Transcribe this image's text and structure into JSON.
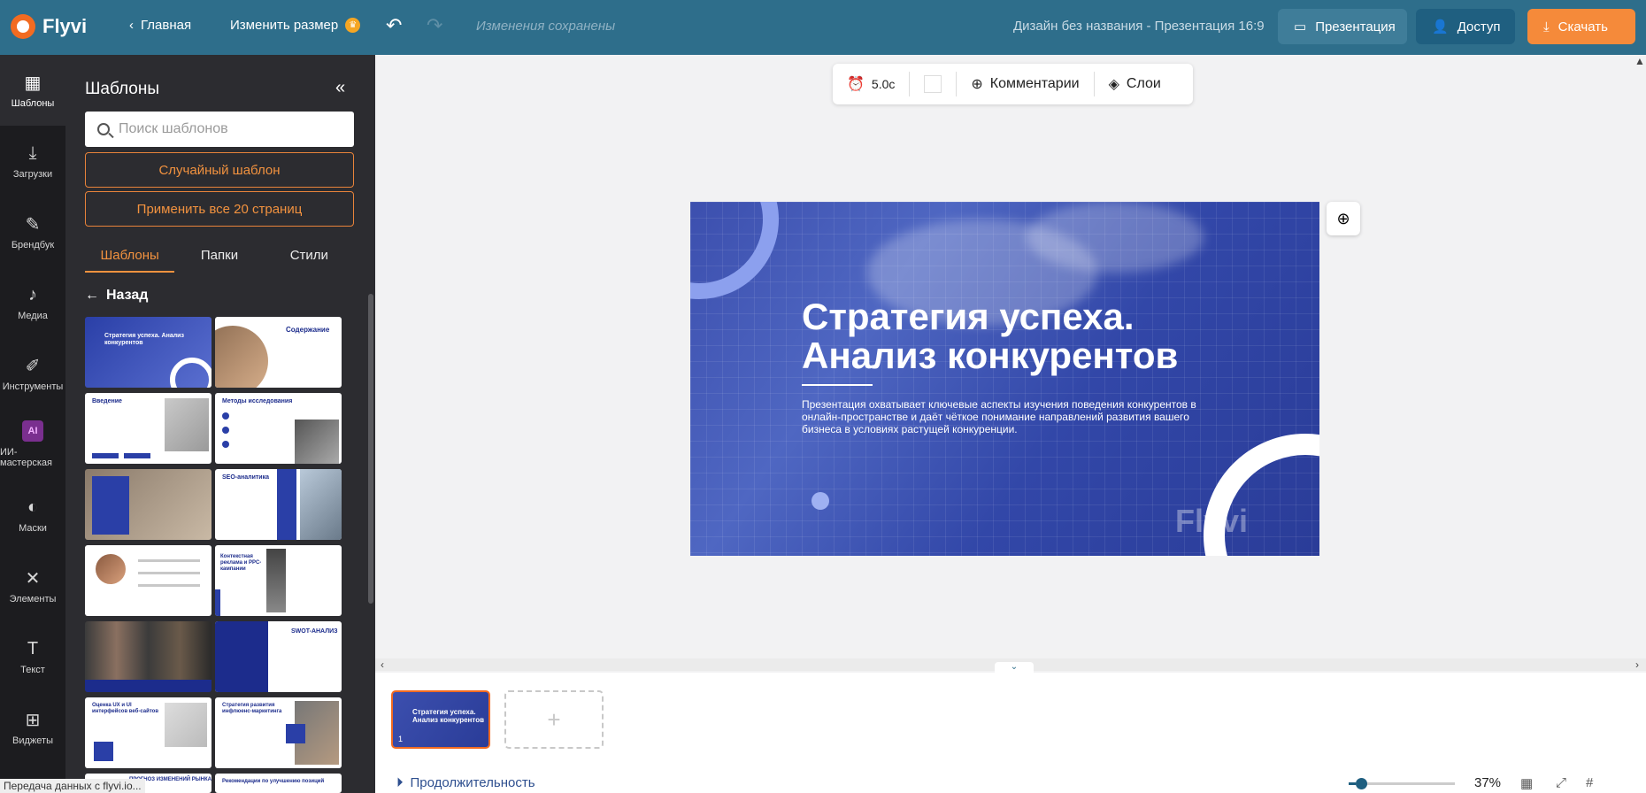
{
  "topbar": {
    "brand": "Flyvi",
    "home": "Главная",
    "resize": "Изменить размер",
    "saved": "Изменения сохранены",
    "doc_name": "Дизайн без названия - Презентация 16:9",
    "present": "Презентация",
    "access": "Доступ",
    "download": "Скачать"
  },
  "rail": [
    {
      "label": "Шаблоны",
      "icon": "template-icon"
    },
    {
      "label": "Загрузки",
      "icon": "download-icon"
    },
    {
      "label": "Брендбук",
      "icon": "brandbook-icon"
    },
    {
      "label": "Медиа",
      "icon": "media-icon"
    },
    {
      "label": "Инструменты",
      "icon": "pen-icon"
    },
    {
      "label": "ИИ-мастерская",
      "icon": "ai-icon"
    },
    {
      "label": "Маски",
      "icon": "mask-icon"
    },
    {
      "label": "Элементы",
      "icon": "elements-icon"
    },
    {
      "label": "Текст",
      "icon": "text-icon"
    },
    {
      "label": "Виджеты",
      "icon": "widgets-icon"
    }
  ],
  "panel": {
    "title": "Шаблоны",
    "search_placeholder": "Поиск шаблонов",
    "random": "Случайный шаблон",
    "apply_all": "Применить все 20 страниц",
    "tabs": [
      "Шаблоны",
      "Папки",
      "Стили"
    ],
    "back": "Назад",
    "thumb_texts": {
      "t1": "Стратегия успеха. Анализ конкурентов",
      "t2": "Содержание",
      "t3": "Введение",
      "t4": "Методы исследования",
      "t6": "SEO-аналитика",
      "t8": "Контекстная реклама и PPC-кампании",
      "t10": "SWOT-АНАЛИЗ",
      "t11": "Оценка UX и UI интерфейсов веб-сайтов",
      "t12": "Стратегия развития инфлюенс-маркетинга",
      "t13": "ПРОГНОЗ ИЗМЕНЕНИЙ РЫНКА",
      "t14": "Рекомендации по улучшению позиций"
    }
  },
  "toolbar": {
    "timer": "5.0с",
    "comments": "Комментарии",
    "layers": "Слои"
  },
  "slide": {
    "title_line1": "Стратегия успеха.",
    "title_line2": "Анализ конкурентов",
    "description": "Презентация охватывает ключевые аспекты изучения поведения конкурентов в онлайн-пространстве и даёт чёткое понимание направлений развития вашего бизнеса в условиях растущей конкуренции.",
    "watermark": "Flyvi"
  },
  "filmstrip": {
    "page_title": "Стратегия успеха. Анализ конкурентов",
    "page_num": "1",
    "add": "+"
  },
  "bottombar": {
    "duration": "Продолжительность",
    "zoom": "37%",
    "zoom_fraction": 0.37
  },
  "status": "Передача данных с flyvi.io..."
}
